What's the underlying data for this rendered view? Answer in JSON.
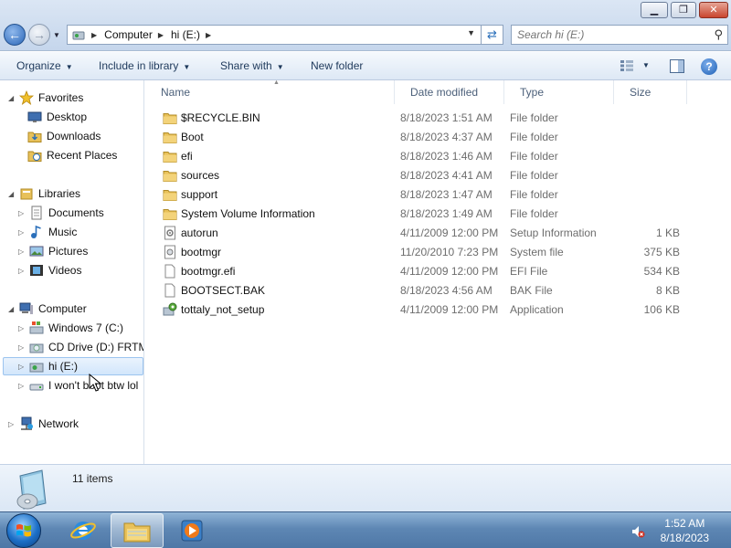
{
  "window": {
    "controls": {
      "minimize": "▁",
      "restore": "❐",
      "close": "✕"
    }
  },
  "address": {
    "crumbs": [
      "Computer",
      "hi (E:)"
    ],
    "search_placeholder": "Search hi (E:)"
  },
  "toolbar": {
    "organize": "Organize",
    "include_in_library": "Include in library",
    "share_with": "Share with",
    "new_folder": "New folder",
    "help": "?"
  },
  "sidebar": {
    "favorites": {
      "label": "Favorites",
      "items": [
        "Desktop",
        "Downloads",
        "Recent Places"
      ]
    },
    "libraries": {
      "label": "Libraries",
      "items": [
        "Documents",
        "Music",
        "Pictures",
        "Videos"
      ]
    },
    "computer": {
      "label": "Computer",
      "items": [
        "Windows 7 (C:)",
        "CD Drive (D:) FRTMEDVD",
        "hi (E:)",
        "I won't boot btw lol"
      ]
    },
    "network": {
      "label": "Network"
    }
  },
  "columns": {
    "name": "Name",
    "date": "Date modified",
    "type": "Type",
    "size": "Size"
  },
  "files": [
    {
      "name": "$RECYCLE.BIN",
      "date": "8/18/2023 1:51 AM",
      "type": "File folder",
      "size": "",
      "icon": "folder-icon"
    },
    {
      "name": "Boot",
      "date": "8/18/2023 4:37 AM",
      "type": "File folder",
      "size": "",
      "icon": "folder-icon"
    },
    {
      "name": "efi",
      "date": "8/18/2023 1:46 AM",
      "type": "File folder",
      "size": "",
      "icon": "folder-icon"
    },
    {
      "name": "sources",
      "date": "8/18/2023 4:41 AM",
      "type": "File folder",
      "size": "",
      "icon": "folder-icon"
    },
    {
      "name": "support",
      "date": "8/18/2023 1:47 AM",
      "type": "File folder",
      "size": "",
      "icon": "folder-icon"
    },
    {
      "name": "System Volume Information",
      "date": "8/18/2023 1:49 AM",
      "type": "File folder",
      "size": "",
      "icon": "folder-icon"
    },
    {
      "name": "autorun",
      "date": "4/11/2009 12:00 PM",
      "type": "Setup Information",
      "size": "1 KB",
      "icon": "setup-info-icon"
    },
    {
      "name": "bootmgr",
      "date": "11/20/2010 7:23 PM",
      "type": "System file",
      "size": "375 KB",
      "icon": "system-file-icon"
    },
    {
      "name": "bootmgr.efi",
      "date": "4/11/2009 12:00 PM",
      "type": "EFI File",
      "size": "534 KB",
      "icon": "file-icon"
    },
    {
      "name": "BOOTSECT.BAK",
      "date": "8/18/2023 4:56 AM",
      "type": "BAK File",
      "size": "8 KB",
      "icon": "file-icon"
    },
    {
      "name": "tottaly_not_setup",
      "date": "4/11/2009 12:00 PM",
      "type": "Application",
      "size": "106 KB",
      "icon": "setup-app-icon"
    }
  ],
  "status": {
    "item_count": "11 items"
  },
  "taskbar": {
    "time": "1:52 AM",
    "date": "8/18/2023"
  },
  "colors": {
    "folder": "#e8c15a",
    "accent": "#1e395b",
    "taskbar": "#5e87b4",
    "selection": "#d2e6fb"
  }
}
